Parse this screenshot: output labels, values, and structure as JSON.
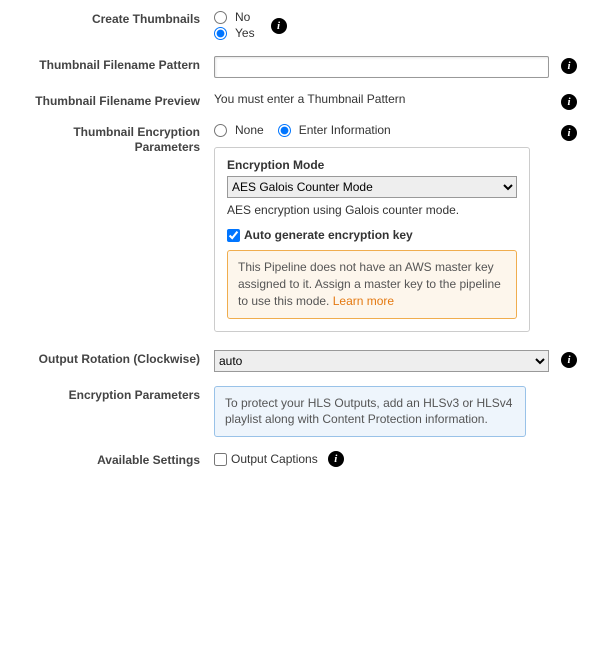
{
  "createThumbnails": {
    "label": "Create Thumbnails",
    "options": {
      "no": "No",
      "yes": "Yes"
    },
    "selected": "yes"
  },
  "thumbnailFilenamePattern": {
    "label": "Thumbnail Filename Pattern",
    "value": ""
  },
  "thumbnailFilenamePreview": {
    "label": "Thumbnail Filename Preview",
    "text": "You must enter a Thumbnail Pattern"
  },
  "thumbnailEncryptionParameters": {
    "label": "Thumbnail Encryption Parameters",
    "options": {
      "none": "None",
      "enter": "Enter Information"
    },
    "selected": "enter",
    "encryptionMode": {
      "label": "Encryption Mode",
      "selected": "AES Galois Counter Mode",
      "description": "AES encryption using Galois counter mode."
    },
    "autoGenerate": {
      "label": "Auto generate encryption key",
      "checked": true
    },
    "warning": {
      "text": "This Pipeline does not have an AWS master key assigned to it. Assign a master key to the pipeline to use this mode. ",
      "link": "Learn more"
    }
  },
  "outputRotation": {
    "label": "Output Rotation (Clockwise)",
    "selected": "auto"
  },
  "encryptionParameters": {
    "label": "Encryption Parameters",
    "text": "To protect your HLS Outputs, add an HLSv3 or HLSv4 playlist along with Content Protection information."
  },
  "availableSettings": {
    "label": "Available Settings",
    "outputCaptions": {
      "label": "Output Captions",
      "checked": false
    }
  }
}
